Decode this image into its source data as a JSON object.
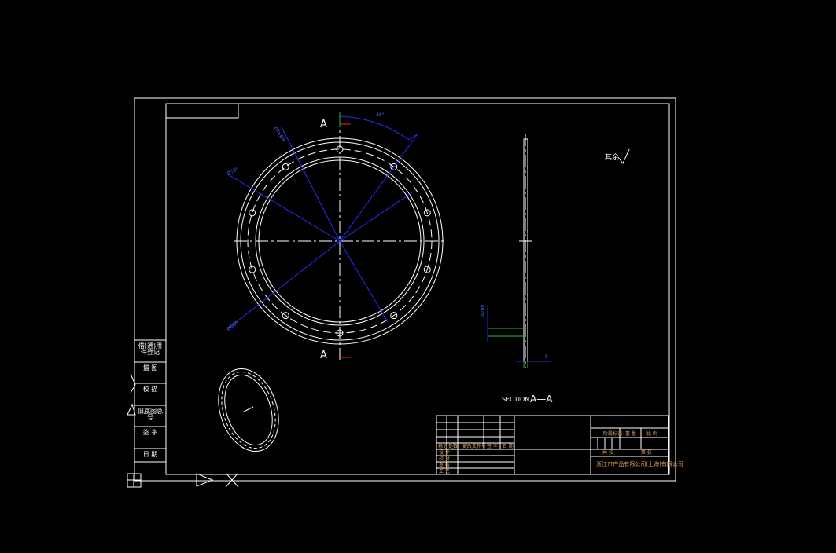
{
  "drawing": {
    "section_marker_top": "A",
    "section_marker_bottom": "A",
    "section_title": "SECTION",
    "section_label": "A—A",
    "surface_finish_note": "其余",
    "dims": {
      "angle": "36°",
      "pcd_label": "20×Ø9",
      "outer_dia": "Ø720",
      "inner_dia": "Ø680",
      "thickness": "5",
      "side_height": "Ø700"
    }
  },
  "side_table": {
    "rows": [
      "借(通)用件登记",
      "描 图",
      "校 描",
      "旧底图总号",
      "签 字",
      "日 期"
    ]
  },
  "title_block": {
    "company": "浙江??产品有限公司(上海)有限公司",
    "header_cells": [
      "标记",
      "处数",
      "更改文件号",
      "签 字",
      "日 期"
    ],
    "left_rows": [
      "设 计",
      "校 对",
      "审 核",
      "工 艺"
    ],
    "right_top": [
      "阶段标记",
      "重 量",
      "比 例"
    ],
    "right_mid": [
      "共 张",
      "第 张"
    ]
  },
  "colors": {
    "line": "#ffffff",
    "dim": "#2030ff",
    "dim_text": "#4a6cff",
    "center": "#ffffff",
    "marker": "#ff2020",
    "accent": "#e0a060",
    "green": "#20c040"
  }
}
